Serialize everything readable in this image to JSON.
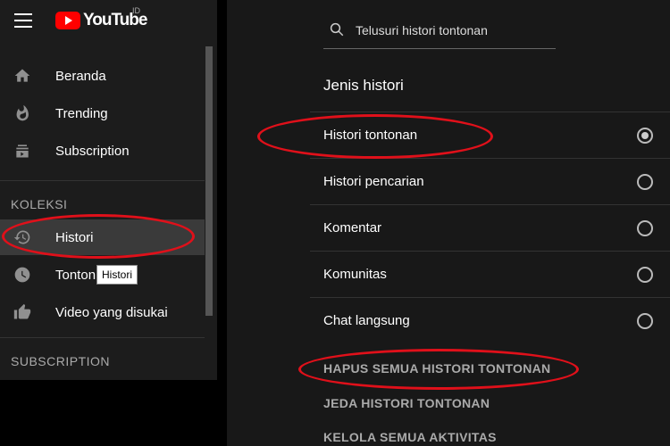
{
  "header": {
    "logo_text": "YouTube",
    "region": "ID"
  },
  "sidebar": {
    "items": [
      {
        "label": "Beranda",
        "icon": "home-icon"
      },
      {
        "label": "Trending",
        "icon": "flame-icon"
      },
      {
        "label": "Subscription",
        "icon": "subscriptions-icon"
      }
    ],
    "collection_title": "KOLEKSI",
    "collection_items": [
      {
        "label": "Histori",
        "icon": "history-icon",
        "active": true
      },
      {
        "label": "Tonton",
        "icon": "clock-icon"
      },
      {
        "label": "Video yang disukai",
        "icon": "thumbs-up-icon"
      }
    ],
    "subscription_title": "SUBSCRIPTION",
    "tooltip": "Histori"
  },
  "main": {
    "search_placeholder": "Telusuri histori tontonan",
    "history_type_title": "Jenis histori",
    "options": [
      {
        "label": "Histori tontonan",
        "selected": true
      },
      {
        "label": "Histori pencarian",
        "selected": false
      },
      {
        "label": "Komentar",
        "selected": false
      },
      {
        "label": "Komunitas",
        "selected": false
      },
      {
        "label": "Chat langsung",
        "selected": false
      }
    ],
    "actions": [
      "HAPUS SEMUA HISTORI TONTONAN",
      "JEDA HISTORI TONTONAN",
      "KELOLA SEMUA AKTIVITAS"
    ]
  },
  "colors": {
    "annotation": "#e0101a",
    "brand": "#ff0000",
    "sidebar_bg": "#1c1c1c",
    "main_bg": "#181818"
  }
}
